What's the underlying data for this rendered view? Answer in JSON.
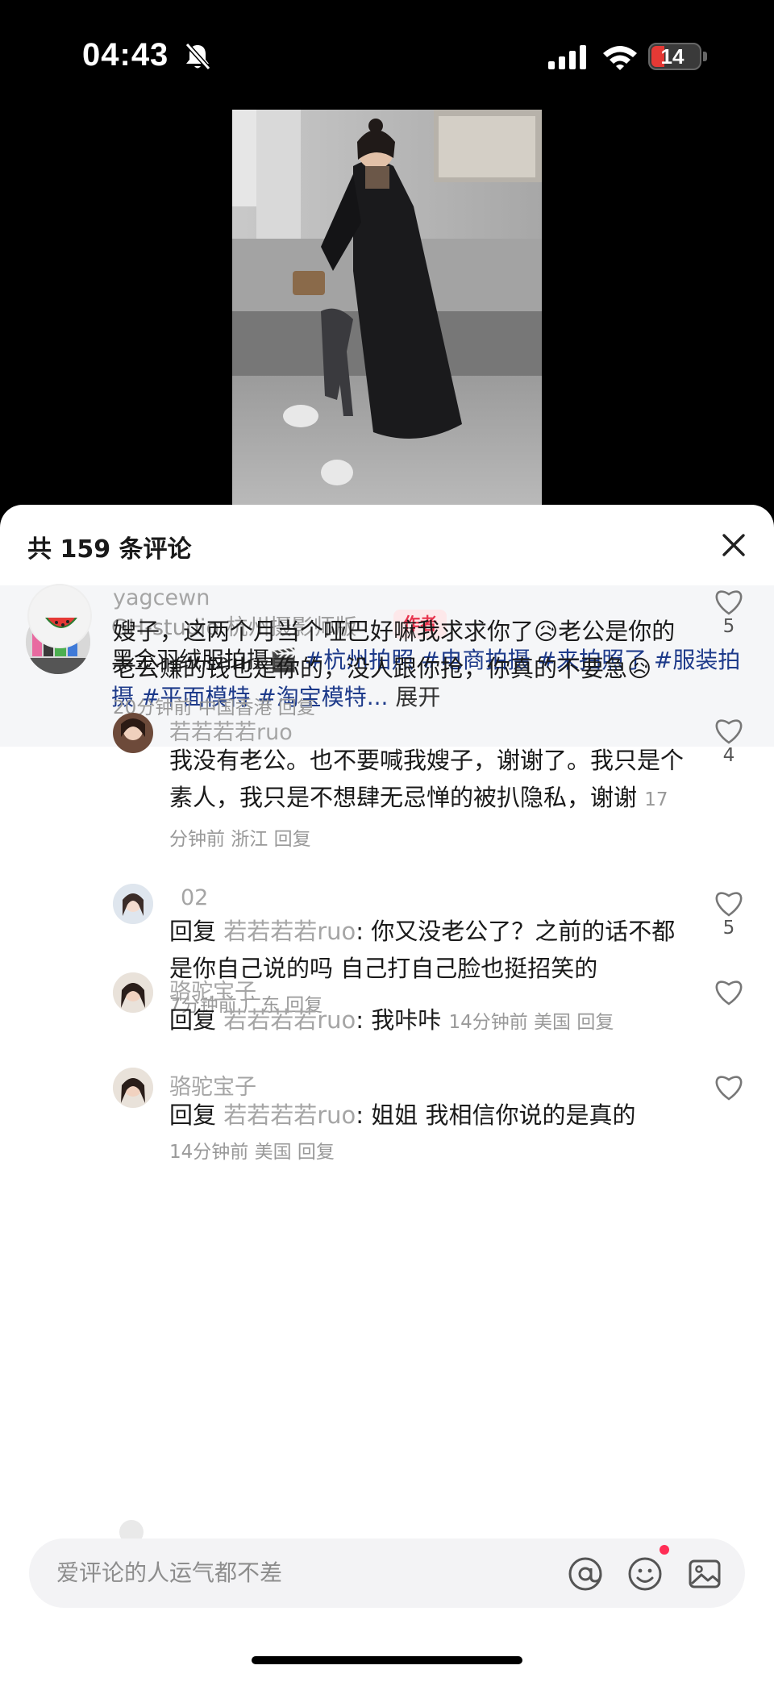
{
  "status_bar": {
    "time": "04:43",
    "battery": "14"
  },
  "sheet": {
    "title": "共 159 条评论"
  },
  "author_post": {
    "name": "GH-studio 杭州摄影师版",
    "tag": "作者",
    "text_prefix": "黑金羽绒服拍摄🎬 ",
    "hashtags": [
      "#杭州拍照",
      "#电商拍摄",
      "#来拍照了",
      "#服装拍摄",
      "#平面模特",
      "#淘宝模特..."
    ],
    "expand": "展开"
  },
  "comments": [
    {
      "name": "yagcewn",
      "text": "嫂子，这两个月当个哑巴好嘛我求求你了😥老公是你的老公赚的钱也是你的，没人跟你抢，你真的不要急😥",
      "meta": "20分钟前 中国香港 回复",
      "likes": "5"
    },
    {
      "name": "若若若若ruo",
      "text": "我没有老公。也不要喊我嫂子，谢谢了。我只是个素人，我只是不想肆无忌惮的被扒隐私，谢谢",
      "meta": "17分钟前 浙江 回复",
      "likes": "4"
    },
    {
      "name": "02",
      "reply_prefix": "回复 ",
      "reply_to": "若若若若ruo",
      "text": ": 你又没老公了？之前的话不都是你自己说的吗 自己打自己脸也挺招笑的",
      "meta": "7分钟前 广东 回复",
      "likes": "5"
    },
    {
      "name": "骆驼宝子",
      "reply_prefix": "回复 ",
      "reply_to": "若若若若ruo",
      "text": ": 我咔咔",
      "meta": "14分钟前 美国 回复",
      "likes": ""
    },
    {
      "name": "骆驼宝子",
      "reply_prefix": "回复 ",
      "reply_to": "若若若若ruo",
      "text": ": 姐姐 我相信你说的是真的",
      "meta": "14分钟前 美国 回复",
      "likes": ""
    }
  ],
  "input": {
    "placeholder": "爱评论的人运气都不差"
  },
  "colors": {
    "hashtag": "#1d3a8a",
    "author_tag_bg": "#fde8ea",
    "author_tag_text": "#e8344e",
    "battery_low": "#e53935"
  }
}
